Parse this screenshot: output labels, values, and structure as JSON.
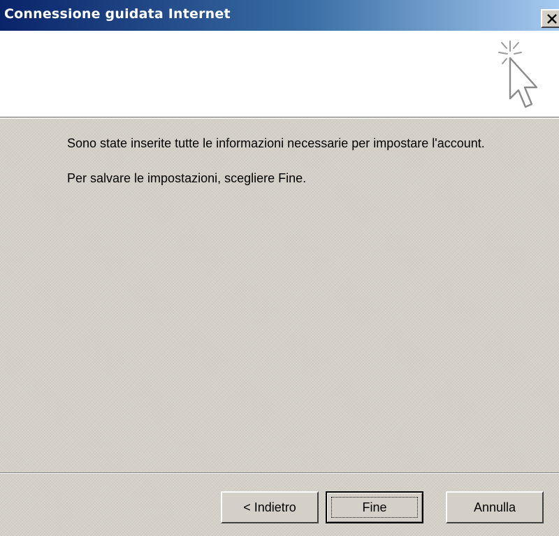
{
  "window": {
    "title": "Connessione guidata Internet"
  },
  "header": {
    "icon": "wizard-cursor-icon"
  },
  "content": {
    "line1": "Sono state inserite tutte le informazioni necessarie per impostare l'account.",
    "line2": "Per salvare le impostazioni, scegliere Fine."
  },
  "buttons": {
    "back_label": "< Indietro",
    "finish_label": "Fine",
    "cancel_label": "Annulla"
  },
  "colors": {
    "titlebar_start": "#0a246a",
    "titlebar_end": "#a6caf0",
    "face": "#d4d0c8"
  }
}
